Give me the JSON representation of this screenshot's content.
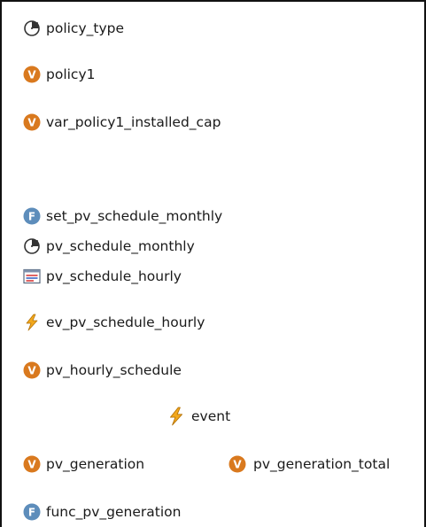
{
  "elements": [
    {
      "label": "policy_type"
    },
    {
      "label": "policy1"
    },
    {
      "label": "var_policy1_installed_cap"
    },
    {
      "label": "set_pv_schedule_monthly"
    },
    {
      "label": "pv_schedule_monthly"
    },
    {
      "label": "pv_schedule_hourly"
    },
    {
      "label": "ev_pv_schedule_hourly"
    },
    {
      "label": "pv_hourly_schedule"
    },
    {
      "label": "event"
    },
    {
      "label": "pv_generation"
    },
    {
      "label": "pv_generation_total"
    },
    {
      "label": "func_pv_generation"
    }
  ],
  "colors": {
    "variable": "#d9791e",
    "function": "#5d8dbb",
    "dynamic": "#333333",
    "event": "#f2a81c",
    "schedule_red": "#d83a3a",
    "schedule_blue": "#3a66c4"
  },
  "icons": {
    "parameter": "dial-parameter-icon",
    "variable": "variable-v-icon",
    "function": "function-f-icon",
    "schedule": "schedule-table-icon",
    "event": "lightning-event-icon"
  }
}
